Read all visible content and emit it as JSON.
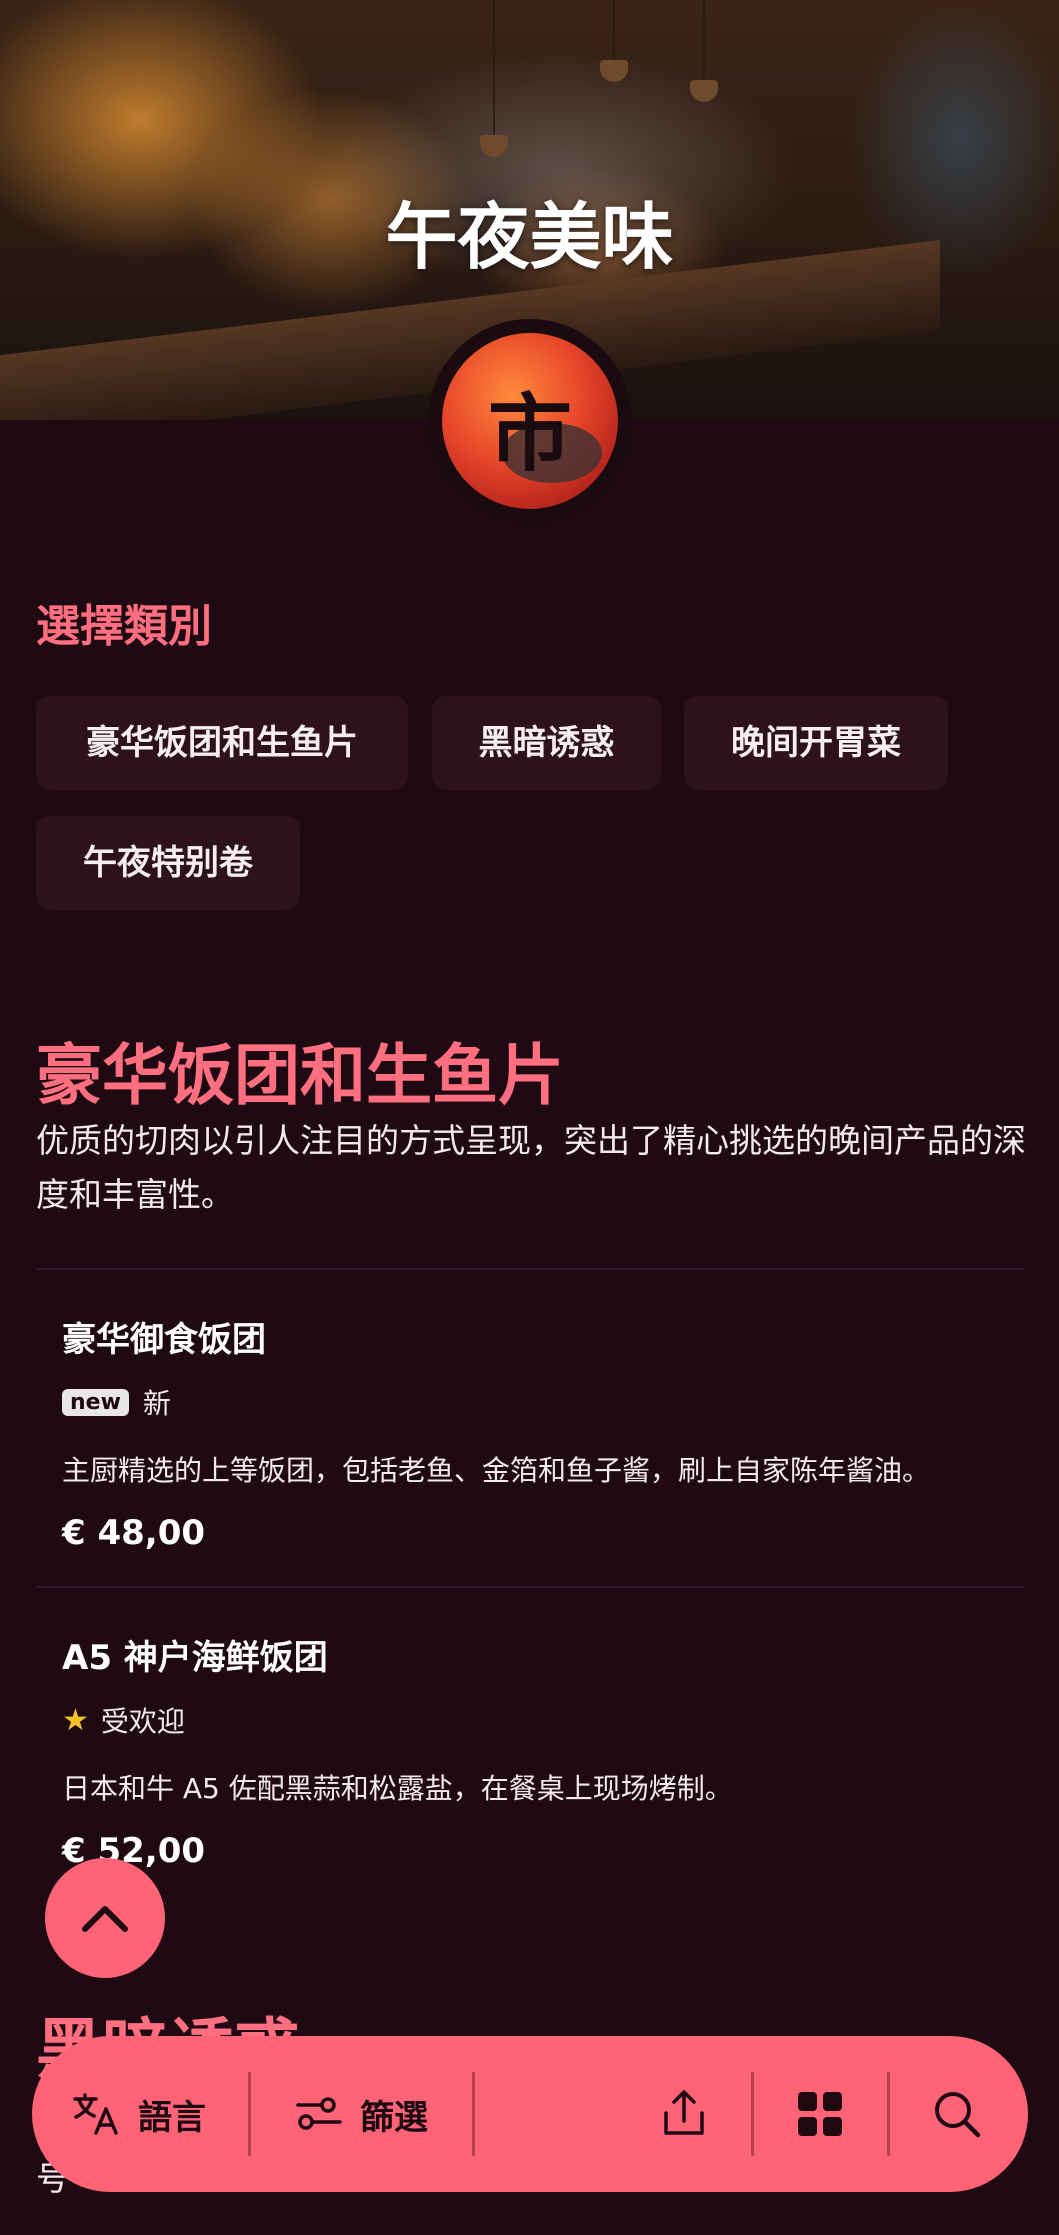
{
  "hero": {
    "title": "午夜美味",
    "logo_glyph": "市"
  },
  "categories": {
    "label": "選擇類別",
    "chips": [
      "豪华饭团和生鱼片",
      "黑暗诱惑",
      "晚间开胃菜",
      "午夜特别卷"
    ]
  },
  "section": {
    "title": "豪华饭团和生鱼片",
    "description": "优质的切肉以引人注目的方式呈现，突出了精心挑选的晚间产品的深度和丰富性。",
    "items": [
      {
        "name": "豪华御食饭团",
        "badge": "new",
        "tag": "新",
        "description": "主厨精选的上等饭团，包括老鱼、金箔和鱼子酱，刷上自家陈年酱油。",
        "price": "€ 48,00"
      },
      {
        "name": "A5 神户海鲜饭团",
        "badge_icon": "star-icon",
        "tag": "受欢迎",
        "description": "日本和牛 A5 佐配黑蒜和松露盐，在餐桌上现场烤制。",
        "price": "€ 52,00"
      }
    ]
  },
  "next_section": {
    "title": "黑暗诱惑",
    "peek": "号"
  },
  "bottom_bar": {
    "language_label": "語言",
    "filter_label": "篩選",
    "icons": [
      "translate-icon",
      "filter-icon",
      "share-icon",
      "grid-icon",
      "search-icon"
    ]
  },
  "colors": {
    "background": "#1f0a14",
    "accent": "#ff6476",
    "heading": "#ff6f7f",
    "chip": "#2d121c",
    "star": "#f5c227"
  }
}
